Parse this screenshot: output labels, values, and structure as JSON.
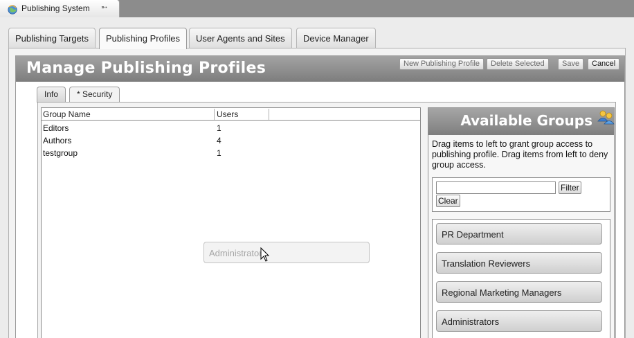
{
  "window": {
    "tab_title": "Publishing System",
    "pin_glyph": "➵"
  },
  "main_tabs": [
    {
      "label": "Publishing Targets",
      "active": false
    },
    {
      "label": "Publishing Profiles",
      "active": true
    },
    {
      "label": "User Agents and Sites",
      "active": false
    },
    {
      "label": "Device Manager",
      "active": false
    }
  ],
  "panel": {
    "title": "Manage Publishing Profiles",
    "buttons": {
      "new_profile": "New Publishing Profile",
      "delete_selected": "Delete Selected",
      "save": "Save",
      "cancel": "Cancel"
    }
  },
  "inner_tabs": [
    {
      "label": "Info",
      "active": false
    },
    {
      "label": "* Security",
      "active": true
    }
  ],
  "grid": {
    "columns": [
      "Group Name",
      "Users"
    ],
    "rows": [
      {
        "name": "Editors",
        "users": "1"
      },
      {
        "name": "Authors",
        "users": "4"
      },
      {
        "name": "testgroup",
        "users": "1"
      }
    ]
  },
  "drag_item": "Administrators",
  "available": {
    "title": "Available Groups",
    "description": "Drag items to left to grant group access to publishing profile. Drag items from left to deny group access.",
    "filter_value": "",
    "filter_button": "Filter",
    "clear_button": "Clear",
    "groups": [
      "PR Department",
      "Translation Reviewers",
      "Regional Marketing Managers",
      "Administrators"
    ]
  }
}
